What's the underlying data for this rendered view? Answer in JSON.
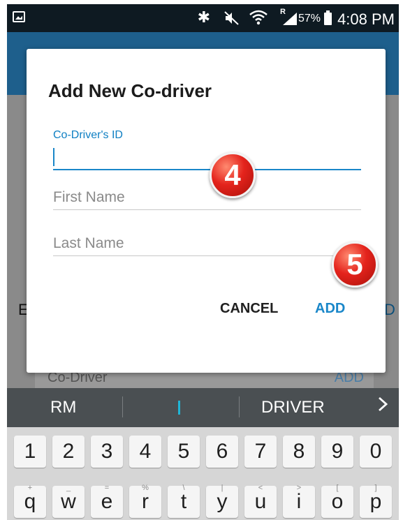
{
  "status_bar": {
    "roaming": "R",
    "battery_percent": "57%",
    "time": "4:08 PM",
    "icons": [
      "gallery-icon",
      "bluetooth-icon",
      "mute-icon",
      "wifi-icon",
      "signal-icon",
      "battery-icon"
    ]
  },
  "background": {
    "partial_left_char": "E",
    "partial_right_char": "D",
    "row_label": "Co-Driver",
    "row_action": "ADD"
  },
  "dialog": {
    "title": "Add New Co-driver",
    "fields": [
      {
        "label": "Co-Driver's ID",
        "value": "",
        "placeholder": ""
      },
      {
        "label": "",
        "value": "",
        "placeholder": "First Name"
      },
      {
        "label": "",
        "value": "",
        "placeholder": "Last Name"
      }
    ],
    "cancel_label": "CANCEL",
    "add_label": "ADD"
  },
  "badges": {
    "step4": "4",
    "step5": "5"
  },
  "keyboard": {
    "suggestions": [
      "RM",
      "",
      "DRIVER"
    ],
    "more_suggestions_icon": "chevron-right-icon",
    "number_row": [
      "1",
      "2",
      "3",
      "4",
      "5",
      "6",
      "7",
      "8",
      "9",
      "0"
    ],
    "letter_row": [
      "q",
      "w",
      "e",
      "r",
      "t",
      "y",
      "u",
      "i",
      "o",
      "p"
    ],
    "letter_hints": [
      "+",
      "_",
      "=",
      "%",
      "\\",
      "|",
      "<",
      ">",
      "[",
      "]"
    ]
  },
  "colors": {
    "status_bar": "#0e1a22",
    "app_bar": "#1e5f8c",
    "accent": "#1a87c9",
    "dim_overlay": "#8a8a8a",
    "keyboard_suggestion_bar": "#4a4f52",
    "keyboard_bg": "#d6d6d6",
    "badge": "#e4231c"
  }
}
